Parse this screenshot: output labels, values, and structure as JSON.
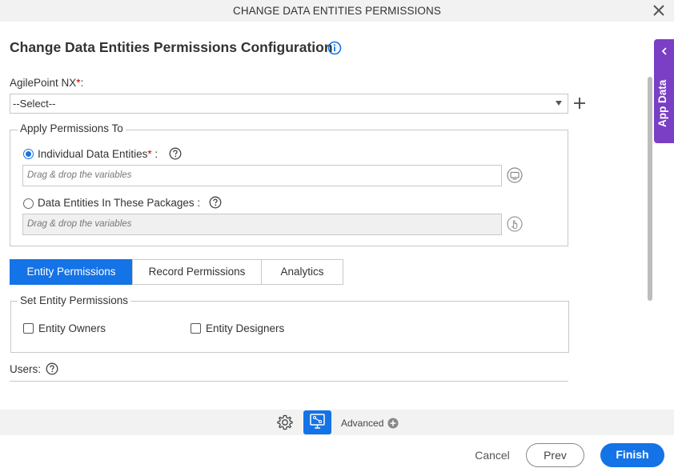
{
  "window": {
    "title": "CHANGE DATA ENTITIES PERMISSIONS",
    "close_icon": "close-icon"
  },
  "page": {
    "heading": "Change Data Entities Permissions Configuration",
    "info_icon": "info-icon"
  },
  "agilepoint": {
    "label": "AgilePoint NX",
    "required_mark": "*",
    "suffix": ":",
    "selected": "--Select--",
    "add_icon": "plus-icon"
  },
  "apply_permissions": {
    "legend": "Apply Permissions To",
    "individual": {
      "label": "Individual Data Entities",
      "required_mark": "*",
      "suffix": " :",
      "selected": true,
      "placeholder": "Drag & drop the variables"
    },
    "packages": {
      "label": "Data Entities In These Packages :",
      "selected": false,
      "placeholder": "Drag & drop the variables"
    }
  },
  "tabs": [
    {
      "label": "Entity Permissions",
      "active": true
    },
    {
      "label": "Record Permissions",
      "active": false
    },
    {
      "label": "Analytics",
      "active": false
    }
  ],
  "entity_permissions": {
    "legend": "Set Entity Permissions",
    "owners_label": "Entity Owners",
    "designers_label": "Entity Designers"
  },
  "users": {
    "label": "Users:"
  },
  "side_panel": {
    "label": "App Data"
  },
  "toolbar": {
    "advanced_label": "Advanced"
  },
  "footer": {
    "cancel": "Cancel",
    "prev": "Prev",
    "finish": "Finish"
  },
  "colors": {
    "accent": "#1473e6",
    "side_panel": "#7a3fc4",
    "required": "#d00000"
  }
}
